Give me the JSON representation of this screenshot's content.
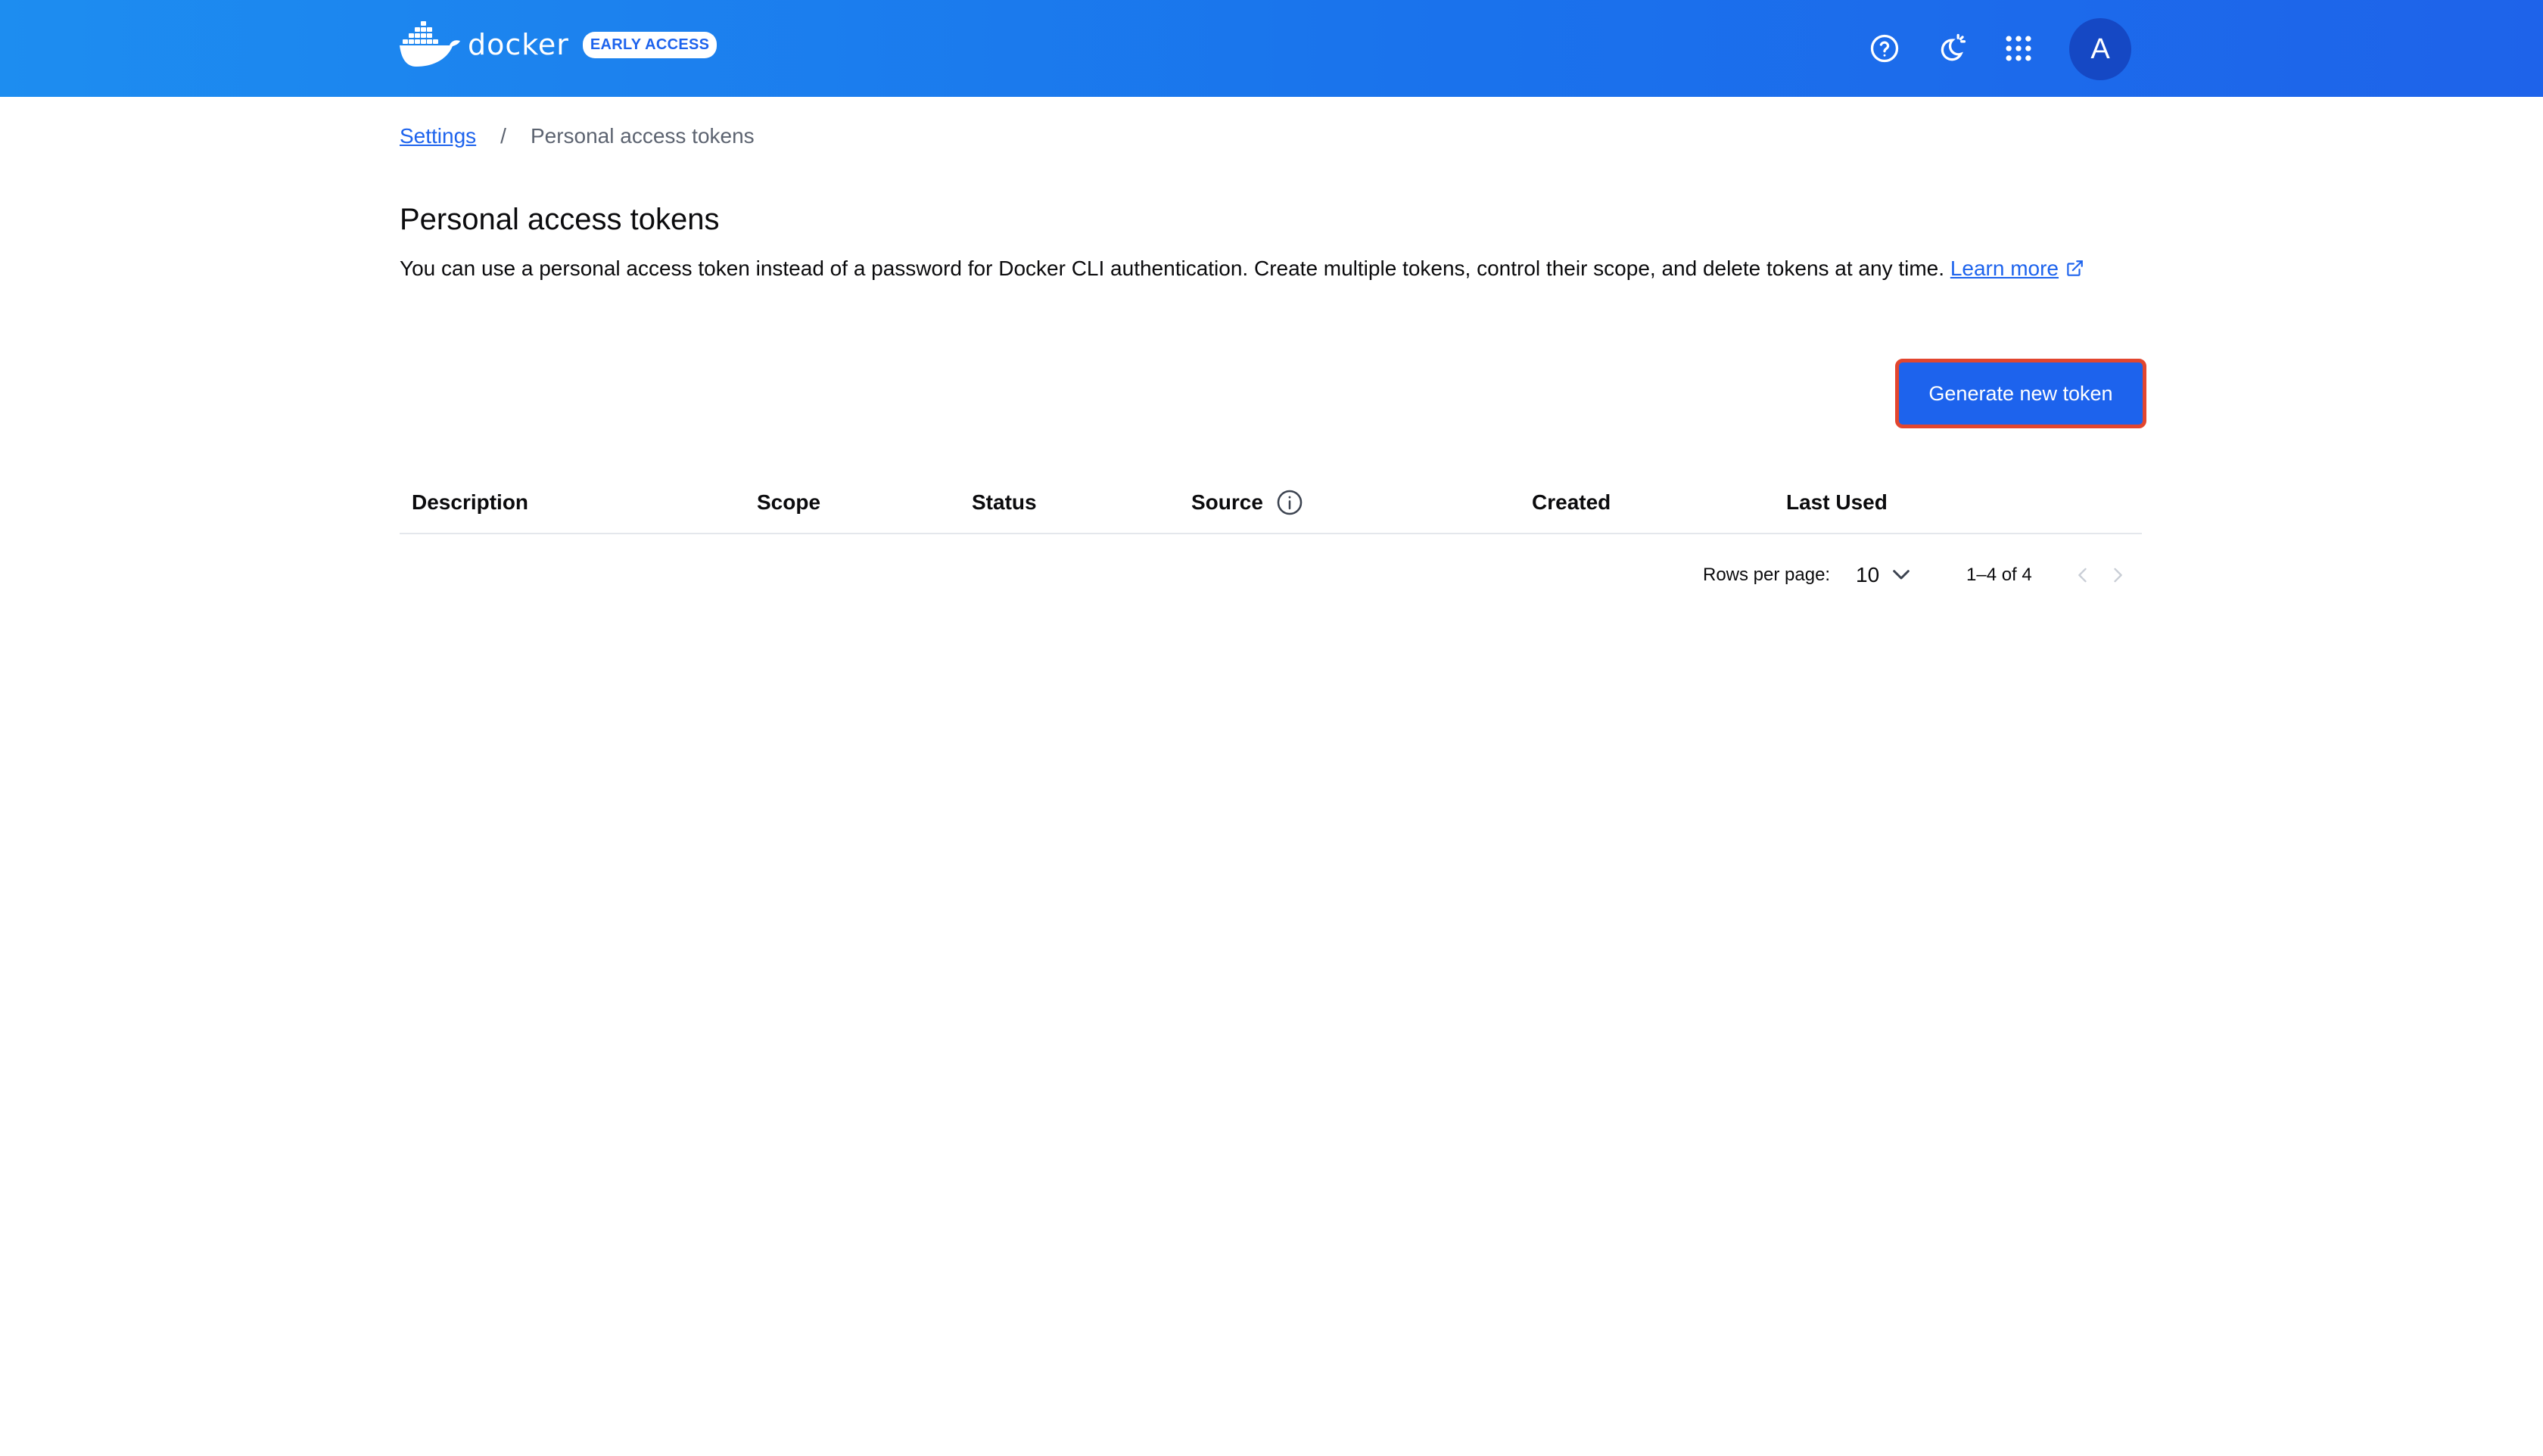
{
  "header": {
    "brand_word": "docker",
    "badge": "EARLY ACCESS",
    "icons": [
      "help-icon",
      "theme-toggle-icon",
      "apps-grid-icon"
    ],
    "avatar_initial": "A",
    "colors": {
      "bar_start": "#1d8df0",
      "bar_end": "#1e63ea",
      "avatar": "#1548c4"
    }
  },
  "breadcrumb": {
    "parent": "Settings",
    "separator": "/",
    "current": "Personal access tokens"
  },
  "page": {
    "title": "Personal access tokens",
    "description": "You can use a personal access token instead of a password for Docker CLI authentication. Create multiple tokens, control their scope, and delete tokens at any time.",
    "learn_more": "Learn more",
    "generate_button": "Generate new token",
    "accent_color": "#1d63ed",
    "highlight_color": "#e2462f"
  },
  "table": {
    "columns": [
      "Description",
      "Scope",
      "Status",
      "Source",
      "Created",
      "Last Used"
    ],
    "rows": []
  },
  "pagination": {
    "rows_per_page_label": "Rows per page:",
    "rows_per_page_value": "10",
    "range": "1–4 of 4"
  }
}
